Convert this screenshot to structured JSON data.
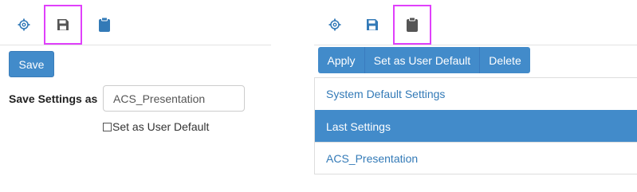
{
  "save_panel": {
    "tabs": [
      {
        "icon": "gear-icon",
        "active": false
      },
      {
        "icon": "floppy-disk-icon",
        "active": true
      },
      {
        "icon": "clipboard-icon",
        "active": false
      }
    ],
    "save_button_label": "Save",
    "save_as_label": "Save Settings as",
    "save_as_value": "ACS_Presentation",
    "user_default_checkbox_label": "Set as User Default",
    "user_default_checked": false
  },
  "load_panel": {
    "tabs": [
      {
        "icon": "gear-icon",
        "active": false
      },
      {
        "icon": "floppy-disk-icon",
        "active": false
      },
      {
        "icon": "clipboard-icon",
        "active": true
      }
    ],
    "buttons": {
      "apply": "Apply",
      "set_user_default": "Set as User Default",
      "delete": "Delete"
    },
    "settings_list": [
      {
        "label": "System Default Settings",
        "selected": false
      },
      {
        "label": "Last Settings",
        "selected": true
      },
      {
        "label": "ACS_Presentation",
        "selected": false
      }
    ]
  },
  "colors": {
    "primary": "#428bca",
    "link": "#337ab7",
    "active_tab_outline": "#e040fb",
    "icon_blue": "#337ab7",
    "icon_dark": "#555555"
  }
}
